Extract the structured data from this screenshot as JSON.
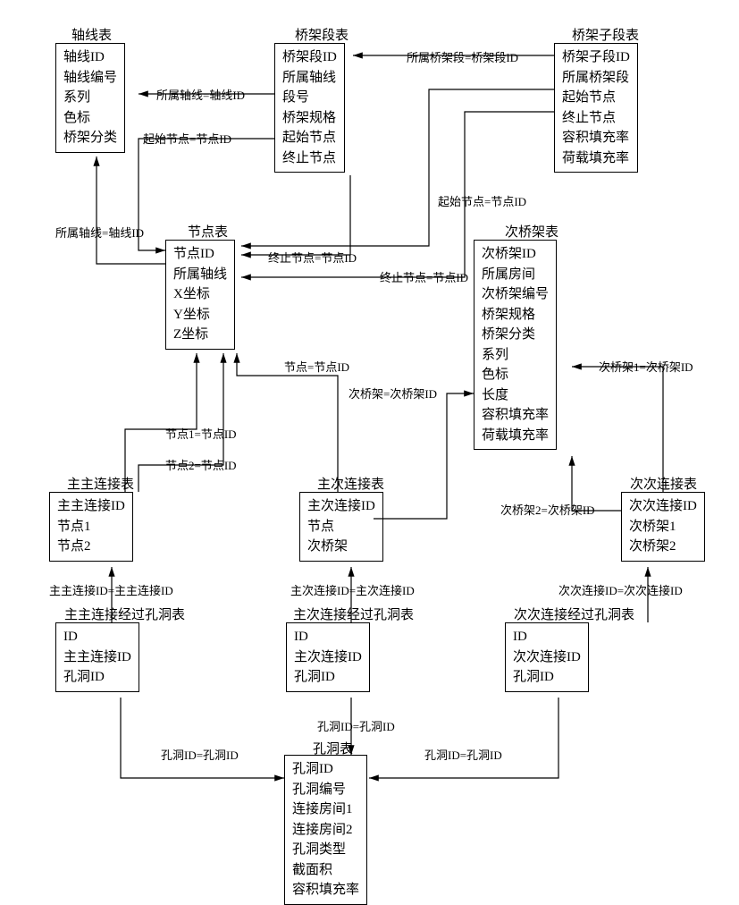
{
  "entities": {
    "axis": {
      "title": "轴线表",
      "fields": [
        "轴线ID",
        "轴线编号",
        "系列",
        "色标",
        "桥架分类"
      ]
    },
    "segment": {
      "title": "桥架段表",
      "fields": [
        "桥架段ID",
        "所属轴线",
        "段号",
        "桥架规格",
        "起始节点",
        "终止节点"
      ]
    },
    "subsegment": {
      "title": "桥架子段表",
      "fields": [
        "桥架子段ID",
        "所属桥架段",
        "起始节点",
        "终止节点",
        "容积填充率",
        "荷载填充率"
      ]
    },
    "node": {
      "title": "节点表",
      "fields": [
        "节点ID",
        "所属轴线",
        "X坐标",
        "Y坐标",
        "Z坐标"
      ]
    },
    "subbridge": {
      "title": "次桥架表",
      "fields": [
        "次桥架ID",
        "所属房间",
        "次桥架编号",
        "桥架规格",
        "桥架分类",
        "系列",
        "色标",
        "长度",
        "容积填充率",
        "荷载填充率"
      ]
    },
    "mm": {
      "title": "主主连接表",
      "fields": [
        "主主连接ID",
        "节点1",
        "节点2"
      ]
    },
    "ms": {
      "title": "主次连接表",
      "fields": [
        "主次连接ID",
        "节点",
        "次桥架"
      ]
    },
    "ss": {
      "title": "次次连接表",
      "fields": [
        "次次连接ID",
        "次桥架1",
        "次桥架2"
      ]
    },
    "mmhole": {
      "title": "主主连接经过孔洞表",
      "fields": [
        "ID",
        "主主连接ID",
        "孔洞ID"
      ]
    },
    "mshole": {
      "title": "主次连接经过孔洞表",
      "fields": [
        "ID",
        "主次连接ID",
        "孔洞ID"
      ]
    },
    "sshole": {
      "title": "次次连接经过孔洞表",
      "fields": [
        "ID",
        "次次连接ID",
        "孔洞ID"
      ]
    },
    "hole": {
      "title": "孔洞表",
      "fields": [
        "孔洞ID",
        "孔洞编号",
        "连接房间1",
        "连接房间2",
        "孔洞类型",
        "截面积",
        "容积填充率"
      ]
    }
  },
  "edgeLabels": {
    "seg_axis": "所属轴线=轴线ID",
    "seg_start": "起始节点=节点ID",
    "seg_end": "终止节点=节点ID",
    "sub_seg": "所属桥架段=桥架段ID",
    "sub_start": "起始节点=节点ID",
    "sub_end": "终止节点=节点ID",
    "node_axis": "所属轴线=轴线ID",
    "mm_n1": "节点1=节点ID",
    "mm_n2": "节点2=节点ID",
    "ms_node": "节点=节点ID",
    "ms_sub": "次桥架=次桥架ID",
    "ss_b1": "次桥架1=次桥架ID",
    "ss_b2": "次桥架2=次桥架ID",
    "mmh_mm": "主主连接ID=主主连接ID",
    "msh_ms": "主次连接ID=主次连接ID",
    "ssh_ss": "次次连接ID=次次连接ID",
    "mmh_hole": "孔洞ID=孔洞ID",
    "msh_hole": "孔洞ID=孔洞ID",
    "ssh_hole": "孔洞ID=孔洞ID"
  }
}
